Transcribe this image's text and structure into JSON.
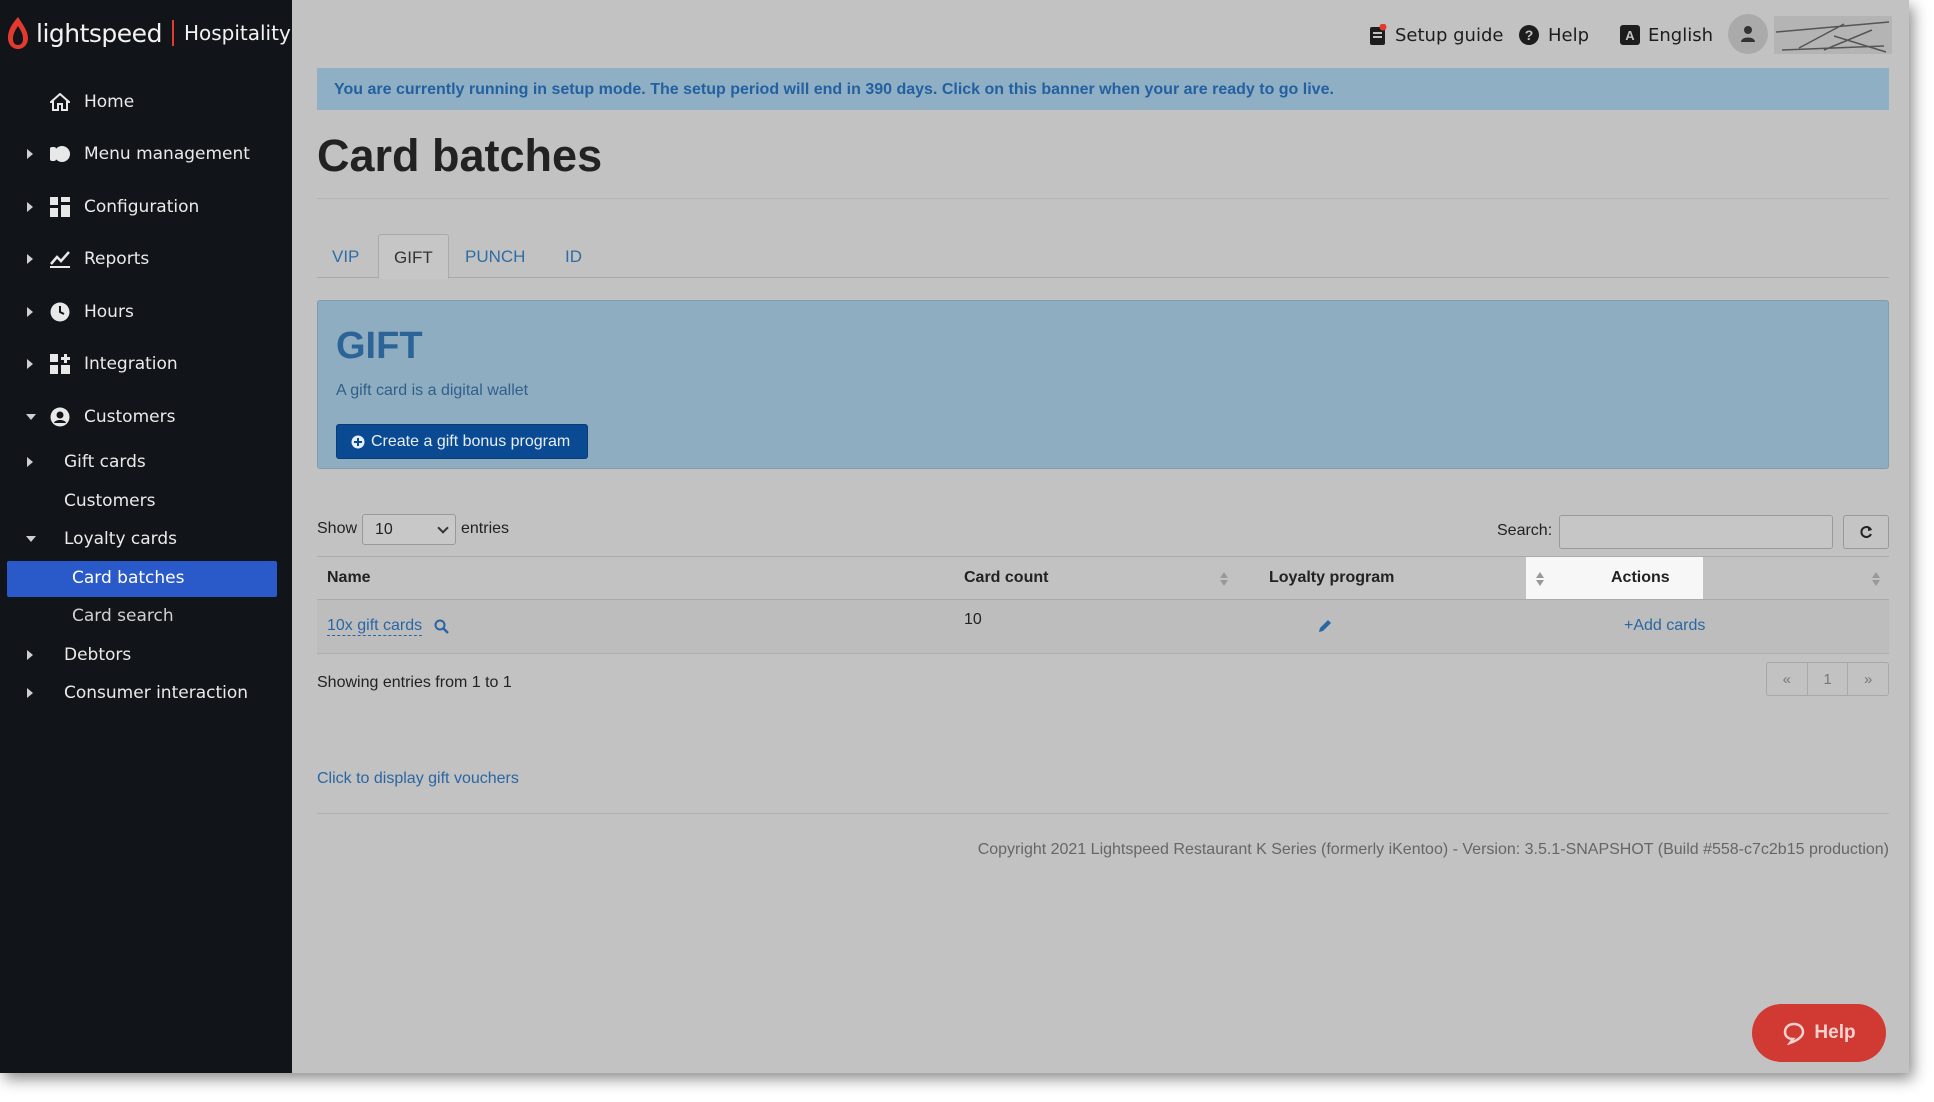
{
  "logo": {
    "brand": "lightspeed",
    "product": "Hospitality"
  },
  "sidebar": {
    "items": [
      {
        "label": "Home",
        "icon": "home-icon"
      },
      {
        "label": "Menu management",
        "icon": "menu-management-icon"
      },
      {
        "label": "Configuration",
        "icon": "configuration-icon"
      },
      {
        "label": "Reports",
        "icon": "reports-icon"
      },
      {
        "label": "Hours",
        "icon": "clock-icon"
      },
      {
        "label": "Integration",
        "icon": "integration-icon"
      },
      {
        "label": "Customers",
        "icon": "customers-icon"
      }
    ],
    "sub_items": [
      {
        "label": "Gift cards"
      },
      {
        "label": "Customers"
      },
      {
        "label": "Loyalty cards"
      },
      {
        "label": "Card batches",
        "active": true
      },
      {
        "label": "Card search"
      },
      {
        "label": "Debtors"
      },
      {
        "label": "Consumer interaction"
      }
    ]
  },
  "topbar": {
    "setup_guide": "Setup guide",
    "help": "Help",
    "language": "English"
  },
  "banner": {
    "text": "You are currently running in setup mode. The setup period will end in 390 days. Click on this banner when your are ready to go live."
  },
  "page": {
    "title": "Card batches"
  },
  "tabs": [
    "VIP",
    "GIFT",
    "PUNCH",
    "ID"
  ],
  "gift_panel": {
    "heading": "GIFT",
    "description": "A gift card is a digital wallet",
    "button": "Create a gift bonus program"
  },
  "table_controls": {
    "show": "Show",
    "entries_value": "10",
    "entries": "entries",
    "search_label": "Search:"
  },
  "table": {
    "headers": [
      "Name",
      "Card count",
      "Loyalty program",
      "Actions"
    ],
    "rows": [
      {
        "name": "10x gift cards",
        "card_count": "10",
        "action": "+Add cards"
      }
    ]
  },
  "pager": {
    "prev": "«",
    "page": "1",
    "next": "»"
  },
  "showing": "Showing entries from 1 to 1",
  "vouchers_link": "Click to display gift vouchers",
  "copyright": "Copyright 2021 Lightspeed Restaurant K Series (formerly iKentoo) - Version: 3.5.1-SNAPSHOT (Build #558-c7c2b15 production)",
  "help_bubble": "Help",
  "colors": {
    "accent": "#2a59c9",
    "brand_red": "#e23a2e",
    "link": "#2a66a3"
  }
}
